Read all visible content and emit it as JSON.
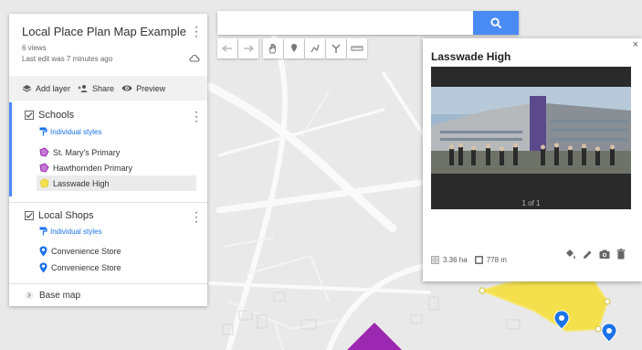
{
  "map": {
    "title": "Local Place Plan Map Example",
    "views": "6 views",
    "last_edit": "Last edit was 7 minutes ago"
  },
  "actions": {
    "add_layer": "Add layer",
    "share": "Share",
    "preview": "Preview"
  },
  "layers": [
    {
      "name": "Schools",
      "styles_label": "Individual styles",
      "items": [
        {
          "label": "St. Mary's Primary",
          "icon": "polygon-icon",
          "color": "#9c27b0"
        },
        {
          "label": "Hawthornden Primary",
          "icon": "polygon-icon",
          "color": "#9c27b0"
        },
        {
          "label": "Lasswade High",
          "icon": "polygon-icon",
          "color": "#f4e04d",
          "selected": true
        }
      ]
    },
    {
      "name": "Local Shops",
      "styles_label": "Individual styles",
      "items": [
        {
          "label": "Convenience Store",
          "icon": "map-pin-icon",
          "color": "#1a73e8"
        },
        {
          "label": "Convenience Store",
          "icon": "map-pin-icon",
          "color": "#1a73e8"
        }
      ]
    }
  ],
  "base_map_label": "Base map",
  "search": {
    "value": "",
    "placeholder": ""
  },
  "card": {
    "title": "Lasswade High",
    "photo_counter": "1 of 1",
    "area": "3.36 ha",
    "perimeter": "778 m",
    "close": "×"
  },
  "colors": {
    "accent": "#4a8af4",
    "school_polygon": "#9c27b0",
    "selected_polygon": "#f4e04d",
    "pin": "#1a73e8"
  }
}
